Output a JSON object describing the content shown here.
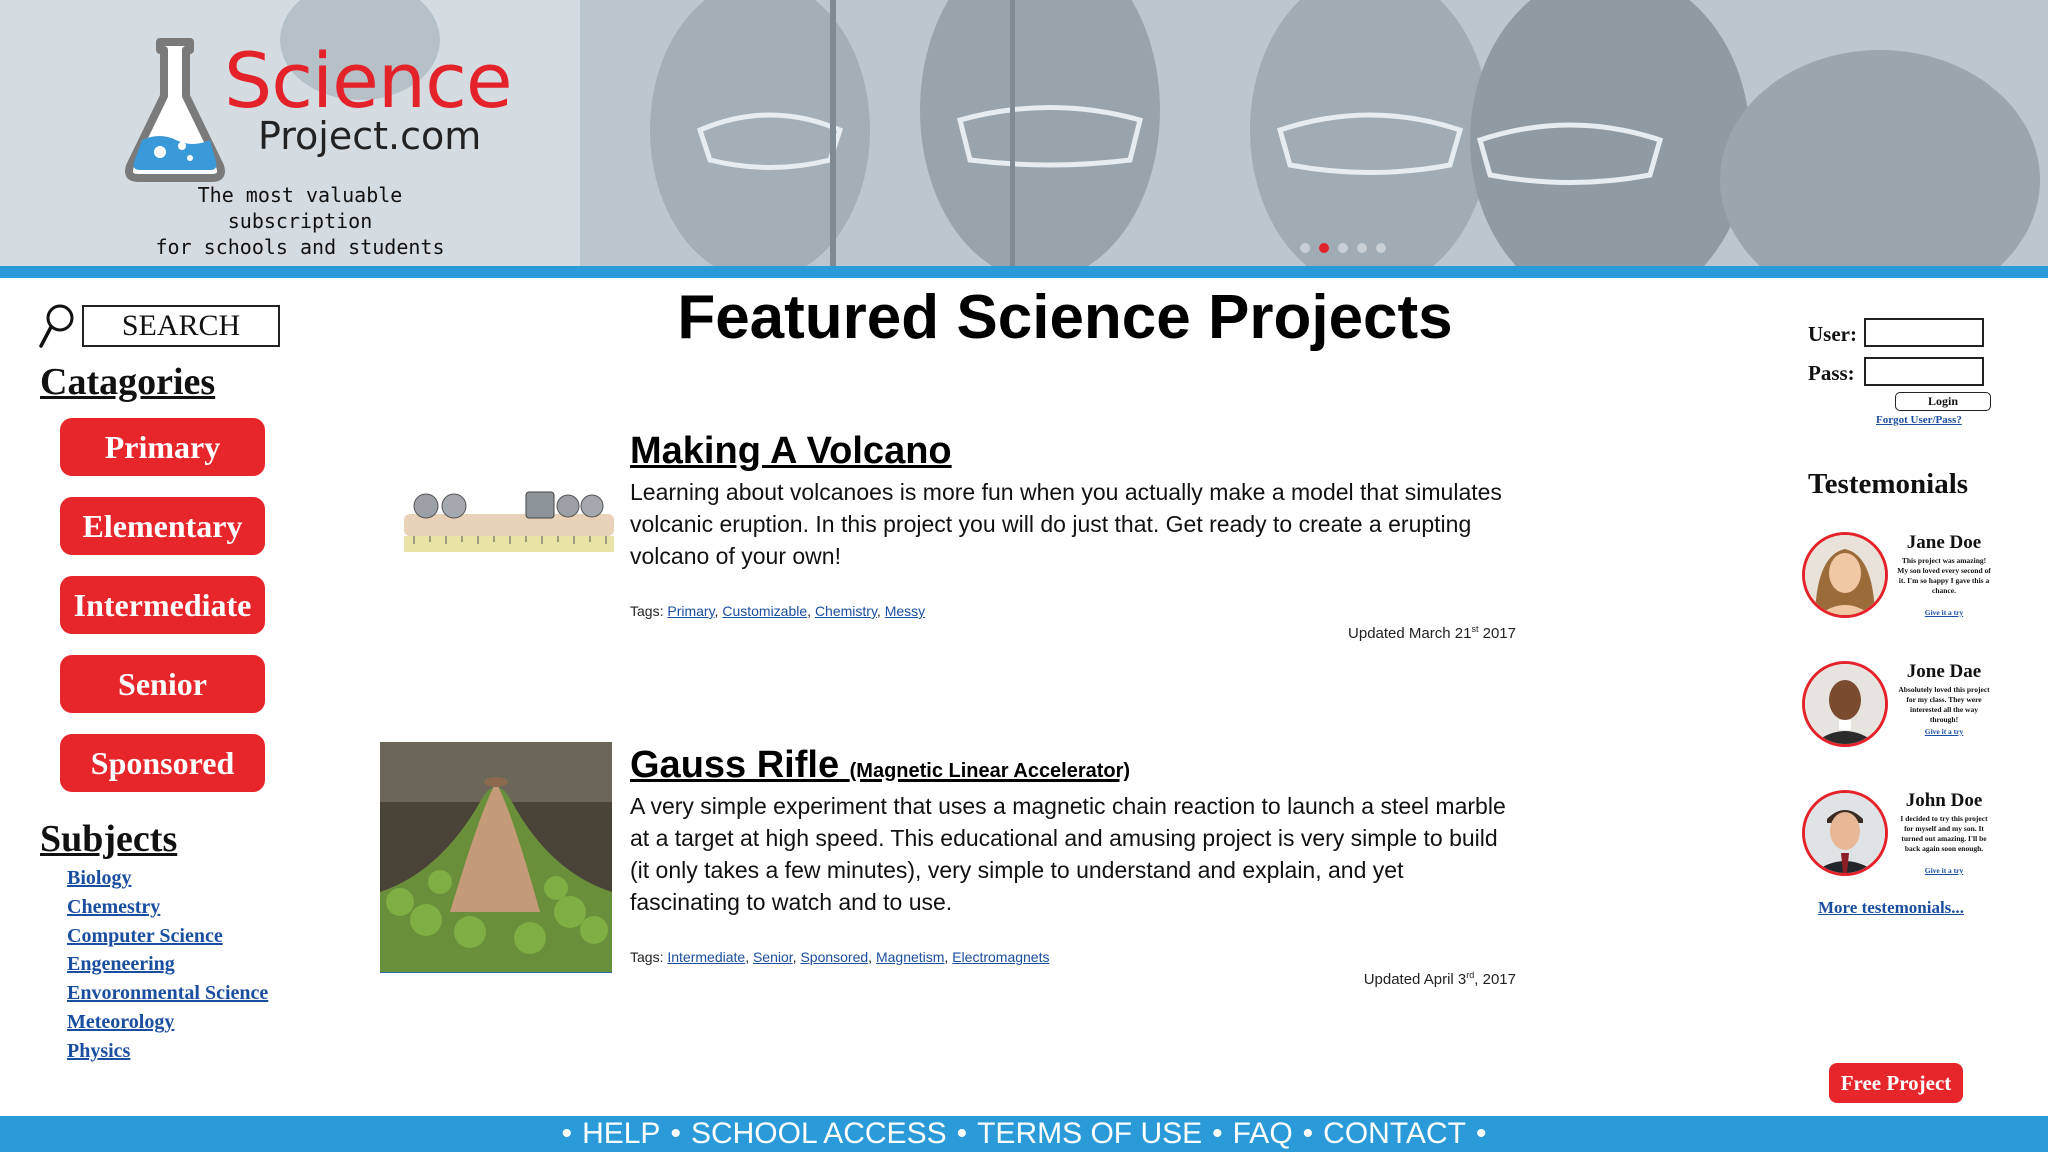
{
  "brand": {
    "name_part1": "Science",
    "name_part2": "Project.com",
    "tagline_line1": "The most valuable subscription",
    "tagline_line2": "for schools and students"
  },
  "carousel": {
    "slide_count": 5,
    "active_index": 1
  },
  "search": {
    "label": "SEARCH"
  },
  "categories": {
    "heading": "Catagories",
    "items": [
      "Primary",
      "Elementary",
      "Intermediate",
      "Senior",
      "Sponsored"
    ]
  },
  "subjects": {
    "heading": "Subjects",
    "items": [
      "Biology",
      "Chemestry",
      "Computer Science",
      "Engeneering",
      "Envoronmental Science",
      "Meteorology",
      "Physics"
    ]
  },
  "main": {
    "title": "Featured Science Projects",
    "projects": [
      {
        "title": "Making A Volcano",
        "subtitle": "",
        "description": "Learning about volcanoes is more fun when you actually make a model that simulates volcanic eruption. In this project you will do just that. Get ready to create a erupting volcano of your own!",
        "tags_label": "Tags: ",
        "tags": [
          "Primary",
          "Customizable",
          "Chemistry",
          "Messy"
        ],
        "updated_prefix": "Updated March 21",
        "updated_sup": "st",
        "updated_suffix": " 2017"
      },
      {
        "title": "Gauss Rifle",
        "subtitle": "(Magnetic Linear Accelerator)",
        "description": "A very simple experiment that uses a magnetic chain reaction to launch a steel marble at a target at high speed. This educational and amusing project is very simple to build (it only takes a few minutes), very simple to understand and explain, and yet fascinating to watch and to use.",
        "tags_label": "Tags: ",
        "tags": [
          "Intermediate",
          "Senior",
          "Sponsored",
          "Magnetism",
          "Electromagnets"
        ],
        "updated_prefix": "Updated April 3",
        "updated_sup": "rd",
        "updated_suffix": ", 2017"
      }
    ]
  },
  "login": {
    "user_label": "User:",
    "pass_label": "Pass:",
    "button": "Login",
    "forgot": "Forgot User/Pass?"
  },
  "testimonials": {
    "heading": "Testemonials",
    "items": [
      {
        "name": "Jane Doe",
        "text": "This project was amazing! My son loved every second of it. I'm so happy I gave this a chance.",
        "link": "Give it a try"
      },
      {
        "name": "Jone Dae",
        "text": "Absolutely loved this project for my class. They were interested all the way through!",
        "link": "Give it a try"
      },
      {
        "name": "John Doe",
        "text": "I decided to try this project for myself and my son. It turned out amazing. I'll be back again soon enough.",
        "link": "Give it a try"
      }
    ],
    "more": "More testemonials..."
  },
  "free_project": "Free Project",
  "footer": {
    "links": [
      "HELP",
      "SCHOOL ACCESS",
      "TERMS OF USE",
      "FAQ",
      "CONTACT"
    ],
    "separator": "•"
  },
  "colors": {
    "accent_red": "#e7262b",
    "accent_blue": "#2a9ad8",
    "link_blue": "#1a4ea0"
  }
}
